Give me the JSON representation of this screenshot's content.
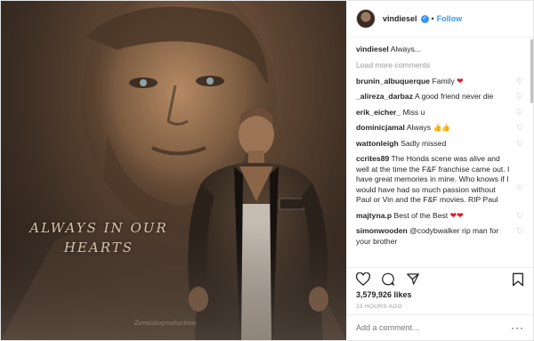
{
  "media": {
    "overlay_line1": "ALWAYS IN OUR",
    "overlay_line2": "HEARTS",
    "watermark": "Zemlakoproduction"
  },
  "header": {
    "username": "vindiesel",
    "follow_label": "Follow"
  },
  "caption": {
    "username": "vindiesel",
    "text": "Always..."
  },
  "load_more": "Load more comments",
  "comments": [
    {
      "user": "brunin_albuquerque",
      "text": "Family",
      "emoji": "heart"
    },
    {
      "user": "_alireza_darbaz",
      "text": "A good friend never die",
      "emoji": ""
    },
    {
      "user": "erik_eicher_",
      "text": "Miss u",
      "emoji": ""
    },
    {
      "user": "dominicjamal",
      "text": "Always",
      "emoji": "thumbs"
    },
    {
      "user": "wattonleigh",
      "text": "Sadly missed",
      "emoji": ""
    },
    {
      "user": "ccrites89",
      "text": "The Honda scene was alive and well at the time the F&F franchise came out. I have great memories in mine. Who knows if I would have had so much passion without Paul or Vin and the F&F movies. RIP Paul",
      "emoji": ""
    },
    {
      "user": "majtyna.p",
      "text": "Best of the Best",
      "emoji": "hearts2"
    },
    {
      "user": "simonwooden",
      "text": "@codybwalker rip man for your brother",
      "emoji": ""
    }
  ],
  "likes": "3,579,926 likes",
  "time": "23 HOURS AGO",
  "add_comment": {
    "placeholder": "Add a comment…",
    "more": "···"
  },
  "colors": {
    "accent": "#3897f0",
    "heart": "#e0192a"
  }
}
